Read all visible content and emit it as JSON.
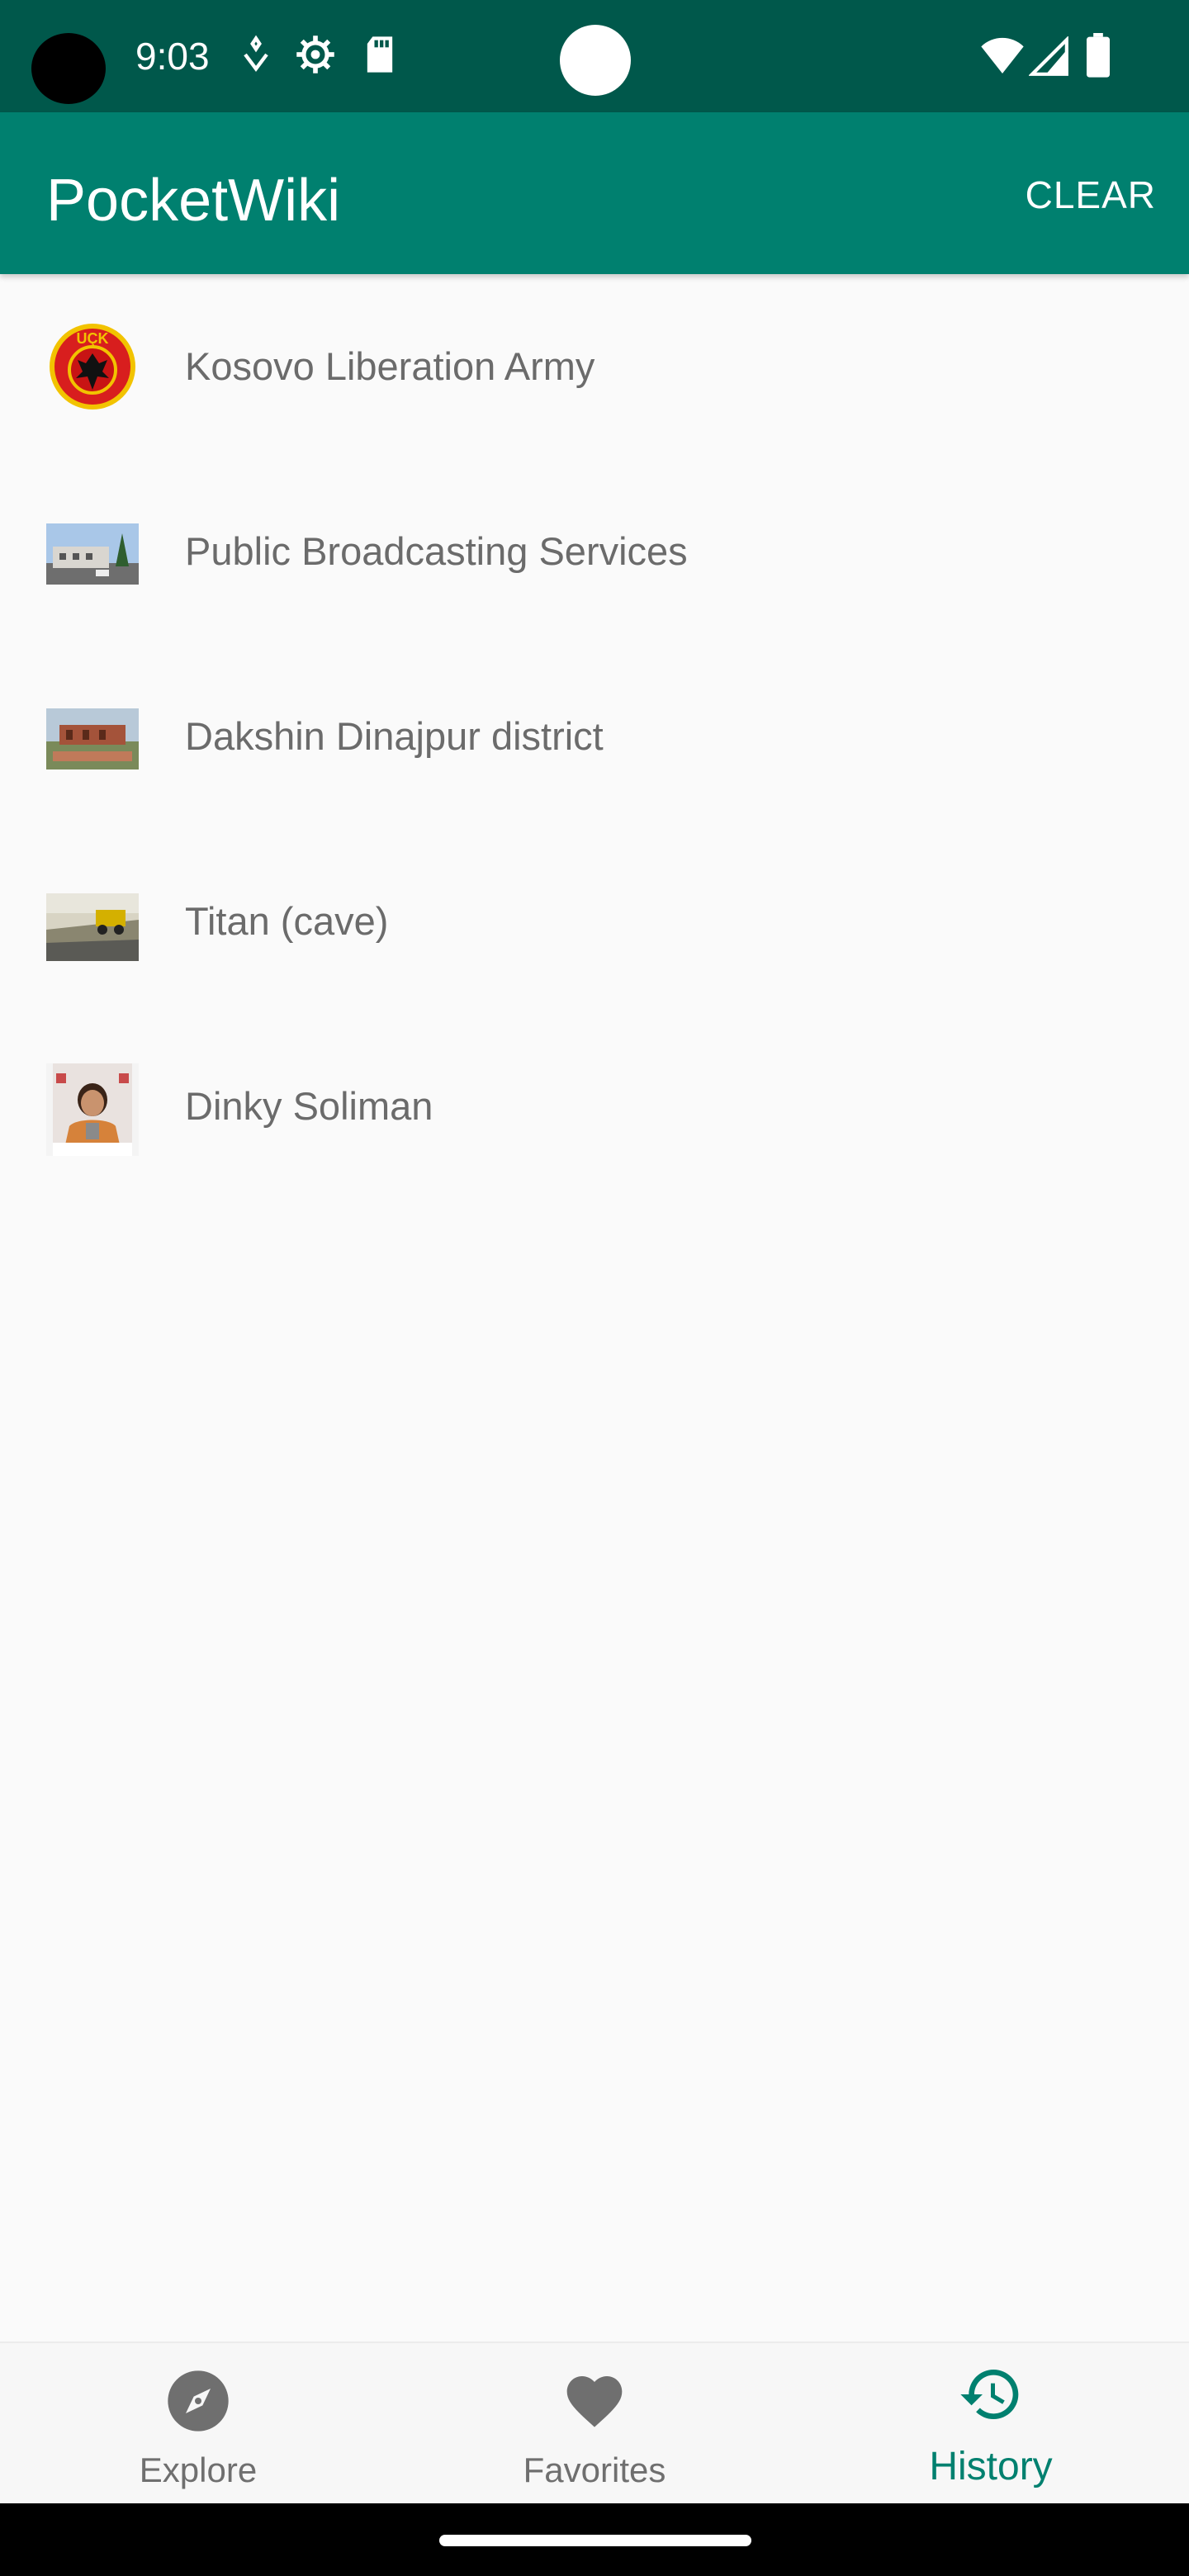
{
  "status_bar": {
    "time": "9:03",
    "icons": [
      "camera-hole",
      "tag-icon",
      "settings-icon",
      "sd-card-icon",
      "wifi-icon",
      "signal-icon",
      "battery-icon"
    ]
  },
  "app_bar": {
    "title": "PocketWiki",
    "clear_label": "CLEAR"
  },
  "history": {
    "items": [
      {
        "label": "Kosovo Liberation Army",
        "thumb": "kla-emblem"
      },
      {
        "label": "Public Broadcasting Services",
        "thumb": "building-photo"
      },
      {
        "label": "Dakshin Dinajpur district",
        "thumb": "ruins-photo"
      },
      {
        "label": "Titan (cave)",
        "thumb": "quarry-truck-photo"
      },
      {
        "label": "Dinky Soliman",
        "thumb": "portrait-photo"
      }
    ]
  },
  "bottom_nav": {
    "items": [
      {
        "label": "Explore",
        "icon": "compass-icon",
        "active": false
      },
      {
        "label": "Favorites",
        "icon": "heart-icon",
        "active": false
      },
      {
        "label": "History",
        "icon": "history-icon",
        "active": true
      }
    ]
  },
  "colors": {
    "status_bar": "#00584b",
    "app_bar": "#00806f",
    "accent": "#00806f",
    "background": "#fafafa",
    "item_text": "#6b6b6b",
    "nav_inactive": "#6f6f6f"
  }
}
